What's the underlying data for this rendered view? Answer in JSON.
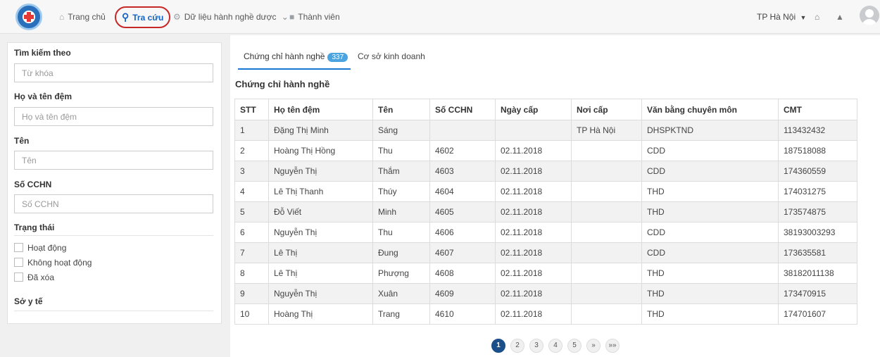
{
  "nav": {
    "home": "Trang chủ",
    "search": "Tra cứu",
    "data": "Dữ liệu hành nghề dược",
    "members": "Thành viên",
    "region": "TP Hà Nội",
    "icons": {
      "home": "home-icon",
      "search": "search-icon",
      "data": "gear-icon",
      "members": "user-icon"
    }
  },
  "filters": {
    "search_by_label": "Tìm kiếm theo",
    "keyword_placeholder": "Từ khóa",
    "middle_name_label": "Họ và tên đệm",
    "middle_name_placeholder": "Họ và tên đệm",
    "name_label": "Tên",
    "name_placeholder": "Tên",
    "cchn_label": "Số CCHN",
    "cchn_placeholder": "Số CCHN",
    "status_label": "Trạng thái",
    "status_options": [
      "Hoạt động",
      "Không hoạt động",
      "Đã xóa"
    ],
    "health_dept_label": "Sở y tế"
  },
  "tabs": {
    "certificates": "Chứng chỉ hành nghề",
    "certificates_count": "337",
    "businesses": "Cơ sở kinh doanh"
  },
  "section_title": "Chứng chỉ hành nghề",
  "table": {
    "headers": [
      "STT",
      "Họ tên đệm",
      "Tên",
      "Số CCHN",
      "Ngày cấp",
      "Nơi cấp",
      "Văn bằng chuyên môn",
      "CMT"
    ],
    "rows": [
      [
        "1",
        "Đặng Thị Minh",
        "Sáng",
        "",
        "",
        "TP Hà Nội",
        "DHSPKTND",
        "113432432"
      ],
      [
        "2",
        "Hoàng Thị Hồng",
        "Thu",
        "4602",
        "02.11.2018",
        "",
        "CDD",
        "187518088"
      ],
      [
        "3",
        "Nguyễn Thị",
        "Thắm",
        "4603",
        "02.11.2018",
        "",
        "CDD",
        "174360559"
      ],
      [
        "4",
        "Lê Thị Thanh",
        "Thúy",
        "4604",
        "02.11.2018",
        "",
        "THD",
        "174031275"
      ],
      [
        "5",
        "Đỗ Viết",
        "Minh",
        "4605",
        "02.11.2018",
        "",
        "THD",
        "173574875"
      ],
      [
        "6",
        "Nguyễn Thị",
        "Thu",
        "4606",
        "02.11.2018",
        "",
        "CDD",
        "38193003293"
      ],
      [
        "7",
        "Lê Thị",
        "Đung",
        "4607",
        "02.11.2018",
        "",
        "CDD",
        "173635581"
      ],
      [
        "8",
        "Lê Thị",
        "Phượng",
        "4608",
        "02.11.2018",
        "",
        "THD",
        "38182011138"
      ],
      [
        "9",
        "Nguyễn Thị",
        "Xuân",
        "4609",
        "02.11.2018",
        "",
        "THD",
        "173470915"
      ],
      [
        "10",
        "Hoàng Thị",
        "Trang",
        "4610",
        "02.11.2018",
        "",
        "THD",
        "174701607"
      ]
    ]
  },
  "pagination": {
    "pages": [
      "1",
      "2",
      "3",
      "4",
      "5"
    ],
    "next": "»",
    "last": "»»",
    "current": "1"
  }
}
